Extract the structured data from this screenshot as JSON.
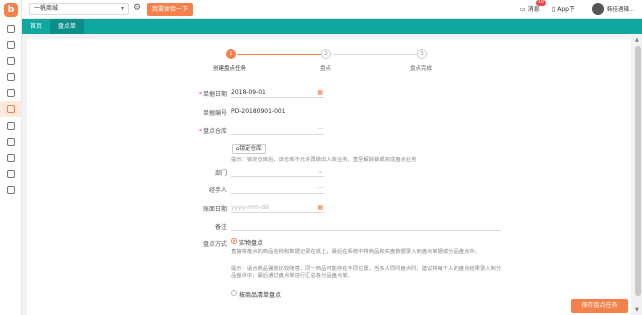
{
  "sidebar": {
    "logo": "b",
    "icons": [
      "home-icon",
      "calendar-icon",
      "tag-icon",
      "box-icon",
      "cart-icon",
      "warehouse-icon",
      "report-icon",
      "card-icon",
      "user-icon",
      "refresh-icon",
      "document-icon"
    ]
  },
  "topbar": {
    "store": "一帆商城",
    "feedback_label": "我要体验一下",
    "messages_label": "消息",
    "messages_badge": "10",
    "app_label": "App下",
    "user_name": "韩佳遇辣…"
  },
  "tabs": {
    "home": "首页",
    "current": "盘点单"
  },
  "steps": [
    {
      "num": "1",
      "label": "创建盘点任务",
      "active": true
    },
    {
      "num": "2",
      "label": "盘点",
      "active": false
    },
    {
      "num": "3",
      "label": "盘点完成",
      "active": false
    }
  ],
  "form": {
    "date_label": "单据日期",
    "date_value": "2018-09-01",
    "number_label": "单据编号",
    "number_value": "PD-20180901-001",
    "warehouse_label": "盘点仓库",
    "warehouse_suffix": "···",
    "lock_label": "锁定仓库",
    "lock_hint": "提示：锁定仓库后，该仓库不允许再做出入库业务，直至解除锁或完成盘点业务",
    "dept_label": "部门",
    "handler_label": "经手人",
    "handler_suffix": "···",
    "account_date_label": "账面日期",
    "account_date_placeholder": "yyyy-mm-dd",
    "remark_label": "备注",
    "method_label": "盘点方式",
    "method_physical": "实物盘点",
    "method_physical_desc": "直接将盘点的商品名称和数据记录在纸上，最后在系统中将商品和实盘数据录入到盘点单据或分品盘点中。",
    "method_physical_hint": "提示：适合商品摆放比较随意，同一商品可能存在不同位置。当多人同时盘点时，建议将每个人的盘点结果录入到分品盘点中，最后通过盘点单进行汇总各分品盘点单。",
    "method_list": "按商品清单盘点"
  },
  "actions": {
    "save_label": "保存盘点任务"
  },
  "colors": {
    "accent": "#f4804a",
    "teal": "#0fa8a0"
  }
}
